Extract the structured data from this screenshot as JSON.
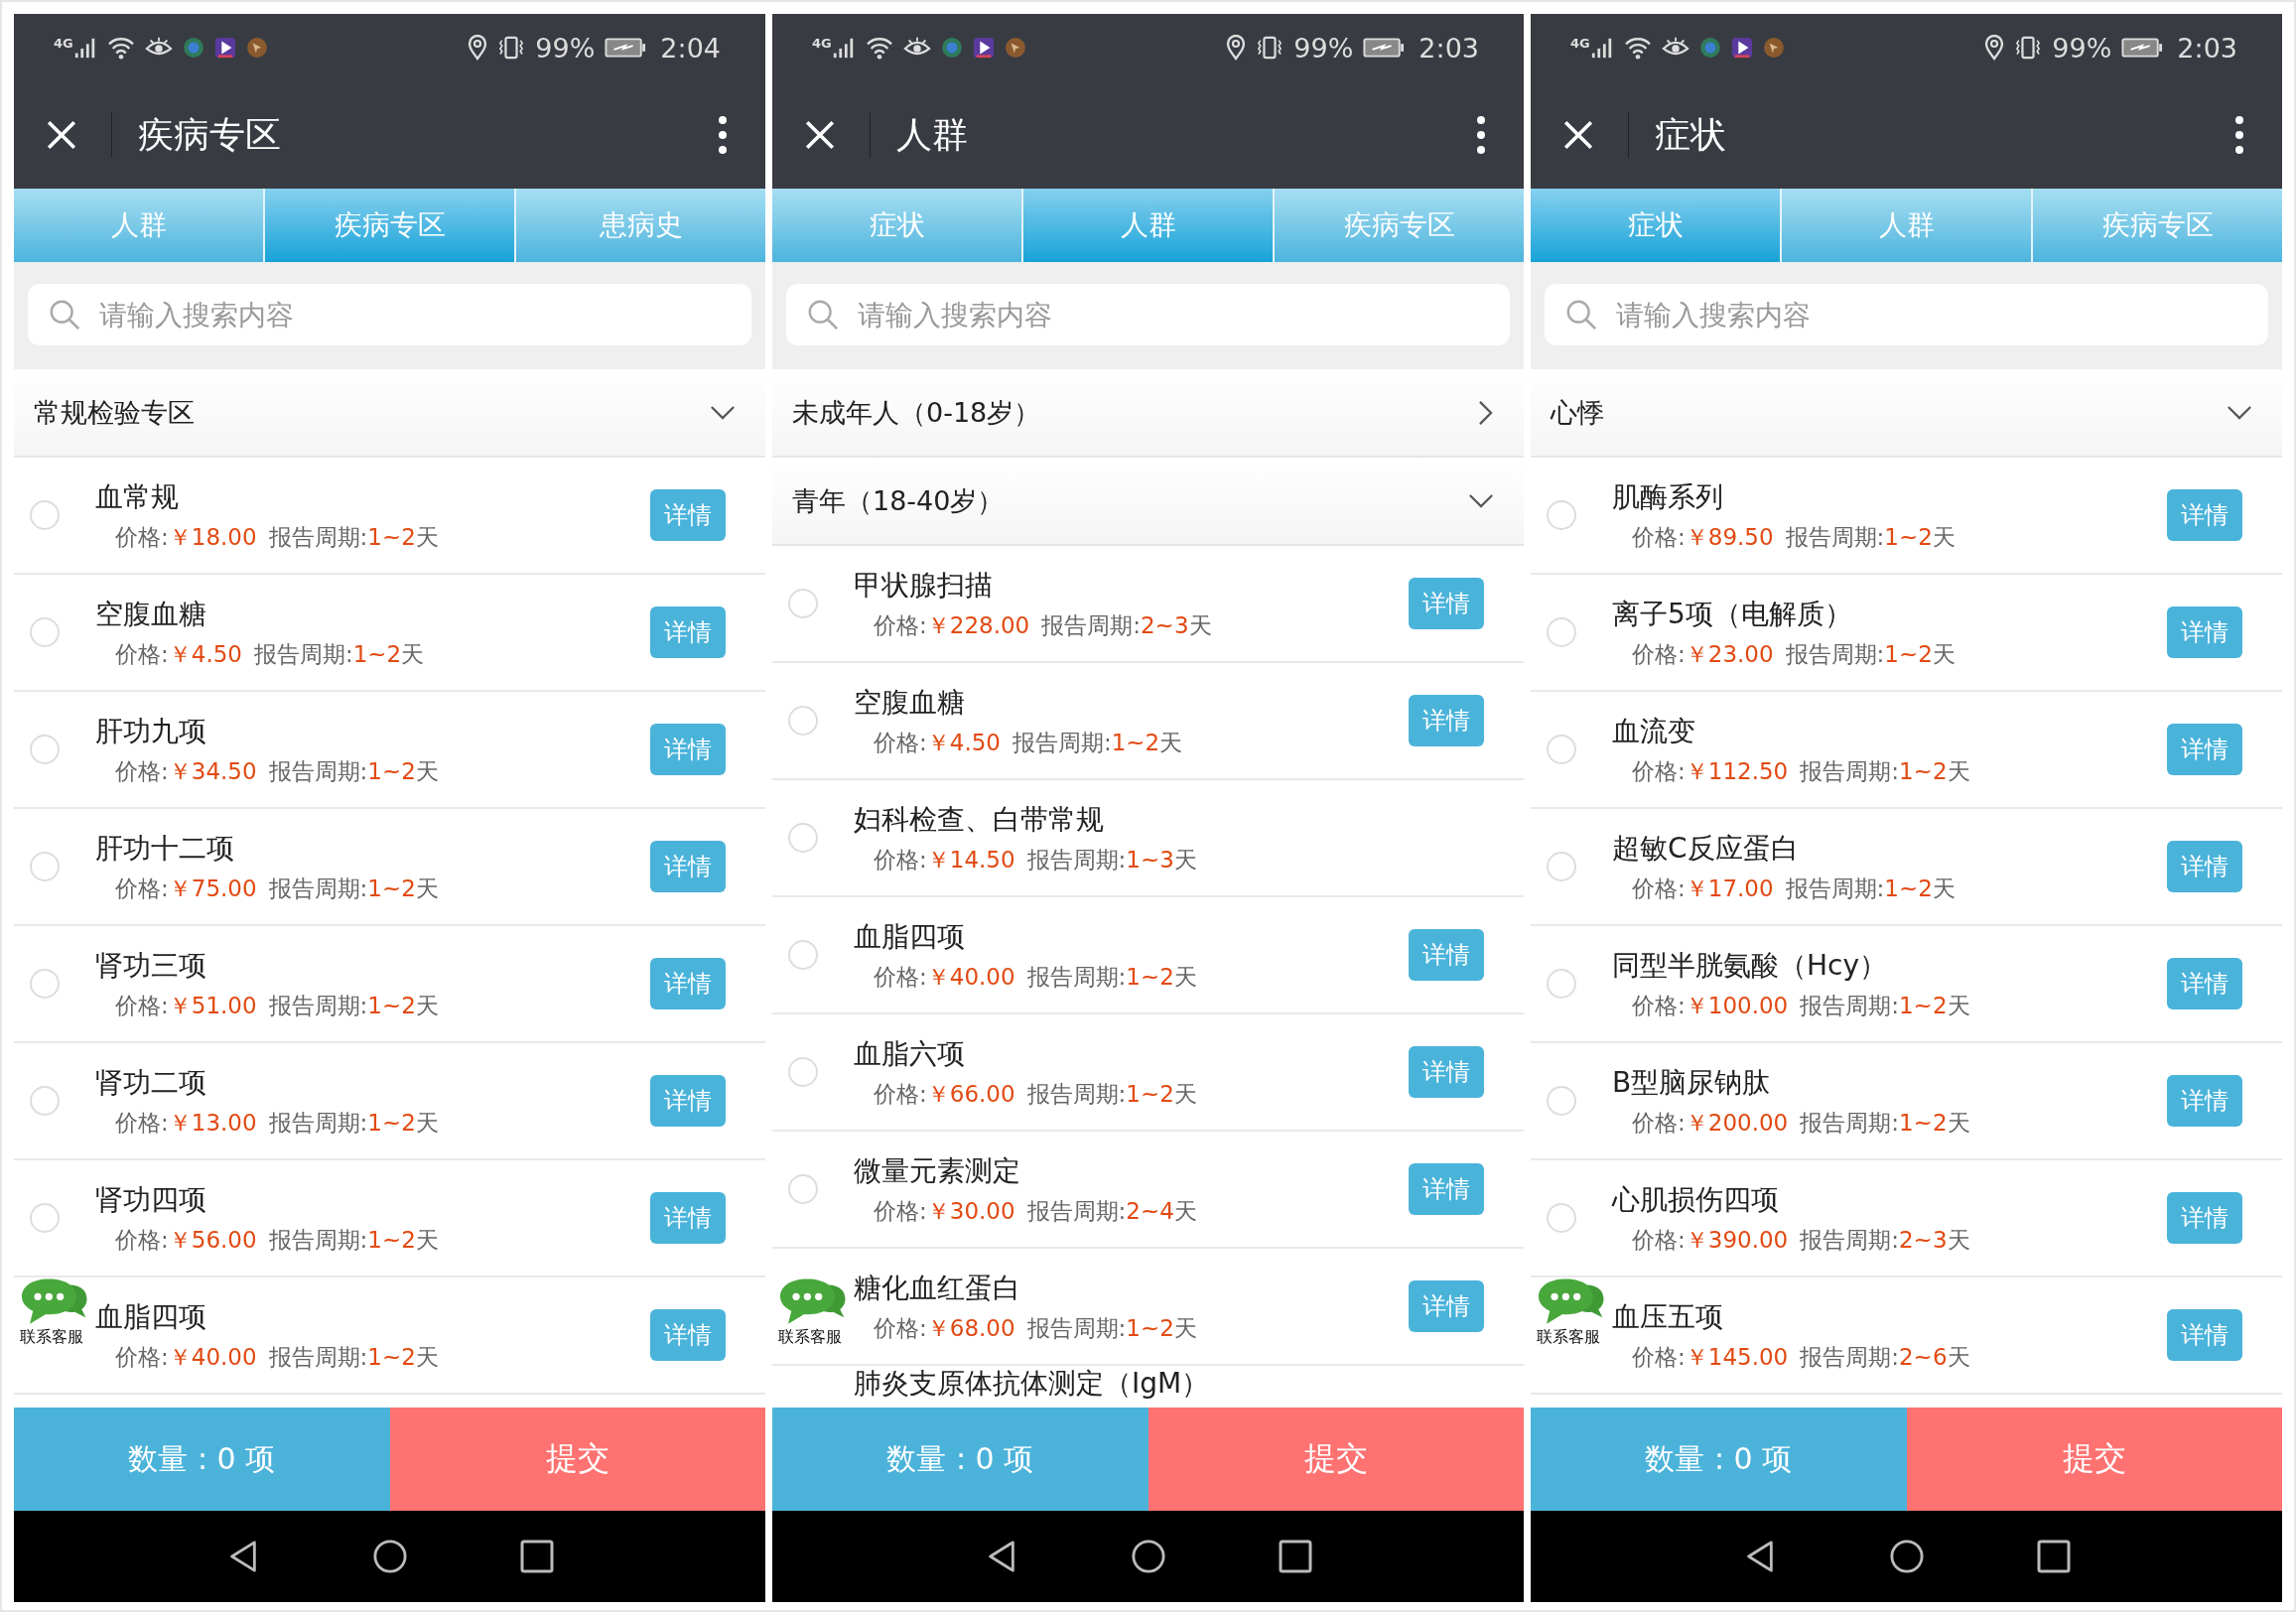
{
  "panels": [
    {
      "status_bar": {
        "network": "4G",
        "battery": "99%",
        "time": "2:04"
      },
      "title": "疾病专区",
      "tabs": [
        {
          "label": "人群",
          "selected": false
        },
        {
          "label": "疾病专区",
          "selected": true
        },
        {
          "label": "患病史",
          "selected": false
        }
      ],
      "search": {
        "placeholder": "请输入搜索内容"
      },
      "groups": [
        {
          "title": "常规检验专区",
          "expanded": true,
          "items": [
            {
              "name": "血常规",
              "checked": false,
              "price_label": "价格:",
              "price": "￥18.00",
              "period_label": "报告周期:",
              "period": "1~2",
              "period_unit": "天",
              "detail": "详情"
            },
            {
              "name": "空腹血糖",
              "checked": false,
              "price_label": "价格:",
              "price": "￥4.50",
              "period_label": "报告周期:",
              "period": "1~2",
              "period_unit": "天",
              "detail": "详情"
            },
            {
              "name": "肝功九项",
              "checked": false,
              "price_label": "价格:",
              "price": "￥34.50",
              "period_label": "报告周期:",
              "period": "1~2",
              "period_unit": "天",
              "detail": "详情"
            },
            {
              "name": "肝功十二项",
              "checked": false,
              "price_label": "价格:",
              "price": "￥75.00",
              "period_label": "报告周期:",
              "period": "1~2",
              "period_unit": "天",
              "detail": "详情"
            },
            {
              "name": "肾功三项",
              "checked": false,
              "price_label": "价格:",
              "price": "￥51.00",
              "period_label": "报告周期:",
              "period": "1~2",
              "period_unit": "天",
              "detail": "详情"
            },
            {
              "name": "肾功二项",
              "checked": false,
              "price_label": "价格:",
              "price": "￥13.00",
              "period_label": "报告周期:",
              "period": "1~2",
              "period_unit": "天",
              "detail": "详情"
            },
            {
              "name": "肾功四项",
              "checked": false,
              "price_label": "价格:",
              "price": "￥56.00",
              "period_label": "报告周期:",
              "period": "1~2",
              "period_unit": "天",
              "detail": "详情"
            },
            {
              "name": "血脂四项",
              "price_label": "价格:",
              "price": "￥40.00",
              "period_label": "报告周期:",
              "period": "1~2",
              "period_unit": "天",
              "detail": "详情"
            }
          ]
        }
      ],
      "footer": {
        "count": "数量 : 0 项",
        "submit": "提交"
      },
      "chat": {
        "label": "联系客服"
      }
    },
    {
      "status_bar": {
        "network": "4G",
        "battery": "99%",
        "time": "2:03"
      },
      "title": "人群",
      "tabs": [
        {
          "label": "症状",
          "selected": false
        },
        {
          "label": "人群",
          "selected": true
        },
        {
          "label": "疾病专区",
          "selected": false
        }
      ],
      "search": {
        "placeholder": "请输入搜索内容"
      },
      "groups": [
        {
          "title": "未成年人（0-18岁）",
          "expanded": false
        },
        {
          "title": "青年（18-40岁）",
          "expanded": true,
          "items": [
            {
              "name": "甲状腺扫描",
              "checked": false,
              "price_label": "价格:",
              "price": "￥228.00",
              "period_label": "报告周期:",
              "period": "2~3",
              "period_unit": "天",
              "detail": "详情"
            },
            {
              "name": "空腹血糖",
              "checked": false,
              "price_label": "价格:",
              "price": "￥4.50",
              "period_label": "报告周期:",
              "period": "1~2",
              "period_unit": "天",
              "detail": "详情"
            },
            {
              "name": "妇科检查、白带常规",
              "checked": false,
              "price_label": "价格:",
              "price": "￥14.50",
              "period_label": "报告周期:",
              "period": "1~3",
              "period_unit": "天"
            },
            {
              "name": "血脂四项",
              "checked": false,
              "price_label": "价格:",
              "price": "￥40.00",
              "period_label": "报告周期:",
              "period": "1~2",
              "period_unit": "天",
              "detail": "详情"
            },
            {
              "name": "血脂六项",
              "checked": false,
              "price_label": "价格:",
              "price": "￥66.00",
              "period_label": "报告周期:",
              "period": "1~2",
              "period_unit": "天",
              "detail": "详情"
            },
            {
              "name": "微量元素测定",
              "checked": false,
              "price_label": "价格:",
              "price": "￥30.00",
              "period_label": "报告周期:",
              "period": "2~4",
              "period_unit": "天",
              "detail": "详情"
            },
            {
              "name": "糖化血红蛋白",
              "price_label": "价格:",
              "price": "￥68.00",
              "period_label": "报告周期:",
              "period": "1~2",
              "period_unit": "天",
              "detail": "详情"
            },
            {
              "name": "肺炎支原体抗体测定（IgM）"
            }
          ]
        }
      ],
      "footer": {
        "count": "数量 : 0 项",
        "submit": "提交"
      },
      "chat": {
        "label": "联系客服"
      }
    },
    {
      "status_bar": {
        "network": "4G",
        "battery": "99%",
        "time": "2:03"
      },
      "title": "症状",
      "tabs": [
        {
          "label": "症状",
          "selected": true
        },
        {
          "label": "人群",
          "selected": false
        },
        {
          "label": "疾病专区",
          "selected": false
        }
      ],
      "search": {
        "placeholder": "请输入搜索内容"
      },
      "groups": [
        {
          "title": "心悸",
          "expanded": true,
          "items": [
            {
              "name": "肌酶系列",
              "checked": false,
              "price_label": "价格:",
              "price": "￥89.50",
              "period_label": "报告周期:",
              "period": "1~2",
              "period_unit": "天",
              "detail": "详情"
            },
            {
              "name": "离子5项（电解质）",
              "checked": false,
              "price_label": "价格:",
              "price": "￥23.00",
              "period_label": "报告周期:",
              "period": "1~2",
              "period_unit": "天",
              "detail": "详情"
            },
            {
              "name": "血流变",
              "checked": false,
              "price_label": "价格:",
              "price": "￥112.50",
              "period_label": "报告周期:",
              "period": "1~2",
              "period_unit": "天",
              "detail": "详情"
            },
            {
              "name": "超敏C反应蛋白",
              "checked": false,
              "price_label": "价格:",
              "price": "￥17.00",
              "period_label": "报告周期:",
              "period": "1~2",
              "period_unit": "天",
              "detail": "详情"
            },
            {
              "name": "同型半胱氨酸（Hcy）",
              "checked": false,
              "price_label": "价格:",
              "price": "￥100.00",
              "period_label": "报告周期:",
              "period": "1~2",
              "period_unit": "天",
              "detail": "详情"
            },
            {
              "name": "B型脑尿钠肽",
              "checked": false,
              "price_label": "价格:",
              "price": "￥200.00",
              "period_label": "报告周期:",
              "period": "1~2",
              "period_unit": "天",
              "detail": "详情"
            },
            {
              "name": "心肌损伤四项",
              "checked": false,
              "price_label": "价格:",
              "price": "￥390.00",
              "period_label": "报告周期:",
              "period": "2~3",
              "period_unit": "天",
              "detail": "详情"
            },
            {
              "name": "血压五项",
              "price_label": "价格:",
              "price": "￥145.00",
              "period_label": "报告周期:",
              "period": "2~6",
              "period_unit": "天",
              "detail": "详情"
            }
          ]
        }
      ],
      "footer": {
        "count": "数量 : 0 项",
        "submit": "提交"
      },
      "chat": {
        "label": "联系客服"
      }
    }
  ]
}
